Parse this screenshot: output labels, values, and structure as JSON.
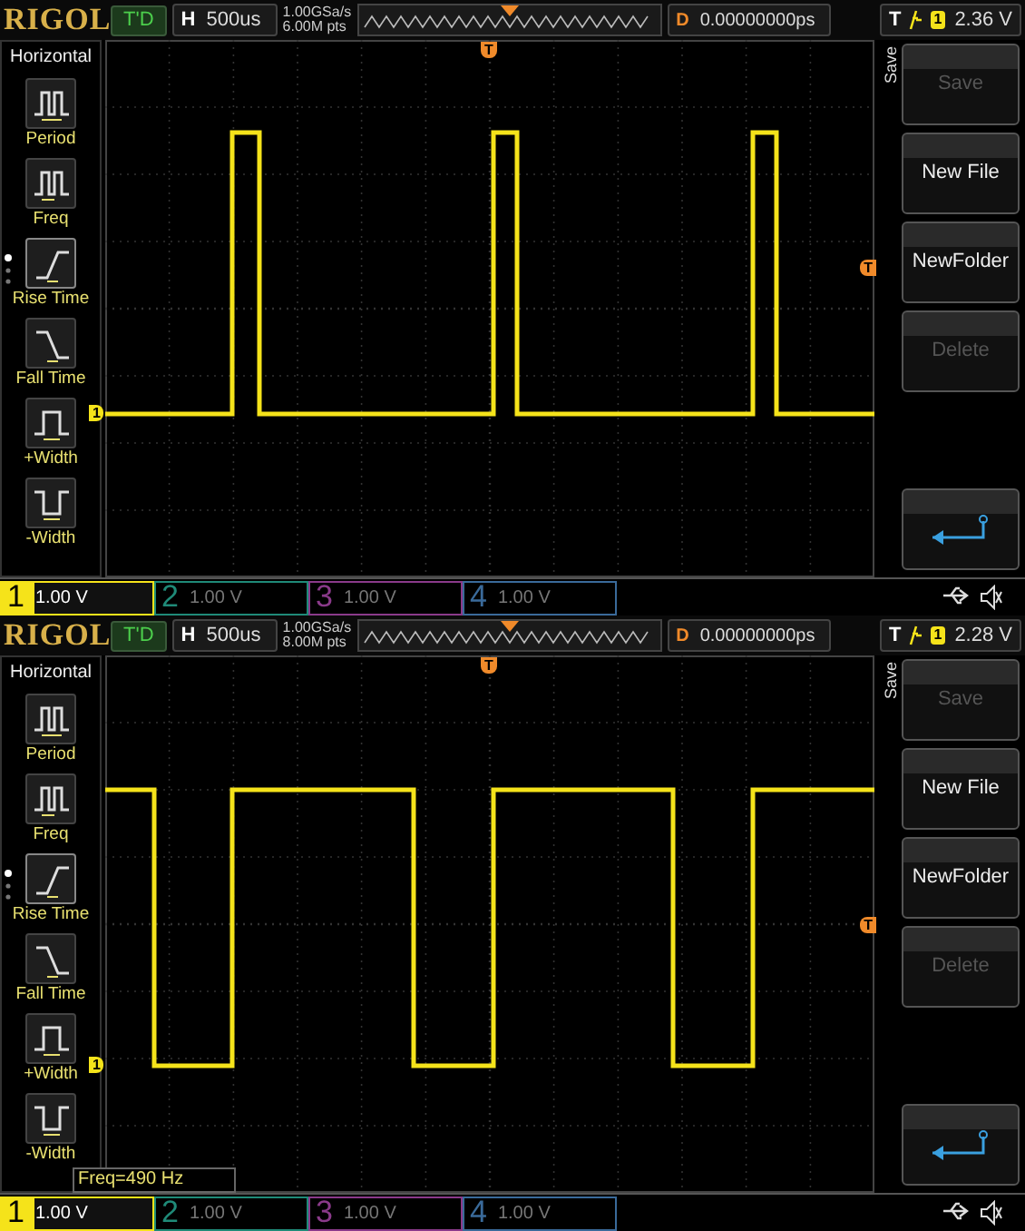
{
  "scopes": [
    {
      "logo": "RIGOL",
      "run_state": "T'D",
      "timebase": {
        "label": "H",
        "value": "500us"
      },
      "sample_rate": "1.00GSa/s",
      "memory_depth": "6.00M pts",
      "delay": {
        "label": "D",
        "value": "0.00000000ps"
      },
      "trigger": {
        "label": "T",
        "channel": "1",
        "level": "2.36 V"
      },
      "sidebar_title": "Horizontal",
      "measurements": [
        {
          "label": "Period",
          "selected": false
        },
        {
          "label": "Freq",
          "selected": false
        },
        {
          "label": "Rise Time",
          "selected": true
        },
        {
          "label": "Fall Time",
          "selected": false
        },
        {
          "label": "+Width",
          "selected": false
        },
        {
          "label": "-Width",
          "selected": false
        }
      ],
      "menu_title": "Save",
      "softkeys": [
        {
          "label": "Save",
          "disabled": true
        },
        {
          "label": "New File",
          "disabled": false
        },
        {
          "label": "NewFolder",
          "disabled": false
        },
        {
          "label": "Delete",
          "disabled": true
        }
      ],
      "trigger_marker": "T",
      "level_marker": "T",
      "channel_marker": "1",
      "channels": [
        {
          "number": "1",
          "scale": "1.00 V",
          "on": true,
          "color": "#f5e31a"
        },
        {
          "number": "2",
          "scale": "1.00 V",
          "on": false,
          "color": "#1f8a78"
        },
        {
          "number": "3",
          "scale": "1.00 V",
          "on": false,
          "color": "#8a3a8a"
        },
        {
          "number": "4",
          "scale": "1.00 V",
          "on": false,
          "color": "#3a6a9a"
        }
      ]
    },
    {
      "logo": "RIGOL",
      "run_state": "T'D",
      "timebase": {
        "label": "H",
        "value": "500us"
      },
      "sample_rate": "1.00GSa/s",
      "memory_depth": "8.00M pts",
      "delay": {
        "label": "D",
        "value": "0.00000000ps"
      },
      "trigger": {
        "label": "T",
        "channel": "1",
        "level": "2.28 V"
      },
      "sidebar_title": "Horizontal",
      "measurements": [
        {
          "label": "Period",
          "selected": false
        },
        {
          "label": "Freq",
          "selected": false
        },
        {
          "label": "Rise Time",
          "selected": true
        },
        {
          "label": "Fall Time",
          "selected": false
        },
        {
          "label": "+Width",
          "selected": false
        },
        {
          "label": "-Width",
          "selected": false
        }
      ],
      "menu_title": "Save",
      "softkeys": [
        {
          "label": "Save",
          "disabled": true
        },
        {
          "label": "New File",
          "disabled": false
        },
        {
          "label": "NewFolder",
          "disabled": false
        },
        {
          "label": "Delete",
          "disabled": true
        }
      ],
      "trigger_marker": "T",
      "level_marker": "T",
      "channel_marker": "1",
      "readout": "Freq=490 Hz",
      "channels": [
        {
          "number": "1",
          "scale": "1.00 V",
          "on": true,
          "color": "#f5e31a"
        },
        {
          "number": "2",
          "scale": "1.00 V",
          "on": false,
          "color": "#1f8a78"
        },
        {
          "number": "3",
          "scale": "1.00 V",
          "on": false,
          "color": "#8a3a8a"
        },
        {
          "number": "4",
          "scale": "1.00 V",
          "on": false,
          "color": "#3a6a9a"
        }
      ]
    }
  ]
}
